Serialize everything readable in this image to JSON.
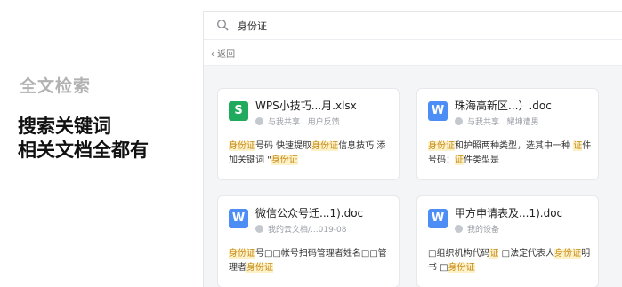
{
  "promo": {
    "subtitle": "全文检索",
    "headline_line1": "搜索关键词",
    "headline_line2": "相关文档全都有"
  },
  "search": {
    "query": "身份证",
    "icon": "search-icon"
  },
  "back_label": "‹ 返回",
  "colors": {
    "excel_green": "#1faa5d",
    "word_blue": "#4c8ef5",
    "highlight_bg": "#fdf1c7",
    "highlight_text": "#c78a1a"
  },
  "results": [
    {
      "file_type": "xlsx",
      "icon_letter": "S",
      "title": "WPS小技巧...月.xlsx",
      "meta": "与我共享...用户反馈",
      "snippet": [
        {
          "t": "身份证",
          "h": true
        },
        {
          "t": "号码 快速提取",
          "h": false
        },
        {
          "t": "身份证",
          "h": true
        },
        {
          "t": "信息技巧 添加关键词 \"",
          "h": false
        },
        {
          "t": "身份证",
          "h": true
        }
      ]
    },
    {
      "file_type": "doc",
      "icon_letter": "W",
      "title": "珠海高新区...）.doc",
      "meta": "与我共享...耀坤遭男",
      "snippet": [
        {
          "t": "身份证",
          "h": true
        },
        {
          "t": "和护照两种类型，选其中一种 ",
          "h": false
        },
        {
          "t": "证",
          "h": true
        },
        {
          "t": "件号码：",
          "h": false
        },
        {
          "t": "证",
          "h": true
        },
        {
          "t": "件类型是",
          "h": false
        }
      ]
    },
    {
      "file_type": "doc",
      "icon_letter": "W",
      "title": "微信公众号迁...1).doc",
      "meta": "我的云文档/...019-08",
      "snippet": [
        {
          "t": "身份证",
          "h": true
        },
        {
          "t": "号□□帐号扫码管理者姓名□□管理者",
          "h": false
        },
        {
          "t": "身份证",
          "h": true
        }
      ]
    },
    {
      "file_type": "doc",
      "icon_letter": "W",
      "title": "甲方申请表及...1).doc",
      "meta": "我的设备",
      "snippet": [
        {
          "t": " □组织机构代码",
          "h": false
        },
        {
          "t": "证",
          "h": true
        },
        {
          "t": " □法定代表人",
          "h": false
        },
        {
          "t": "身份证",
          "h": true
        },
        {
          "t": "明书 □",
          "h": false
        },
        {
          "t": "身份证",
          "h": true
        }
      ]
    }
  ]
}
